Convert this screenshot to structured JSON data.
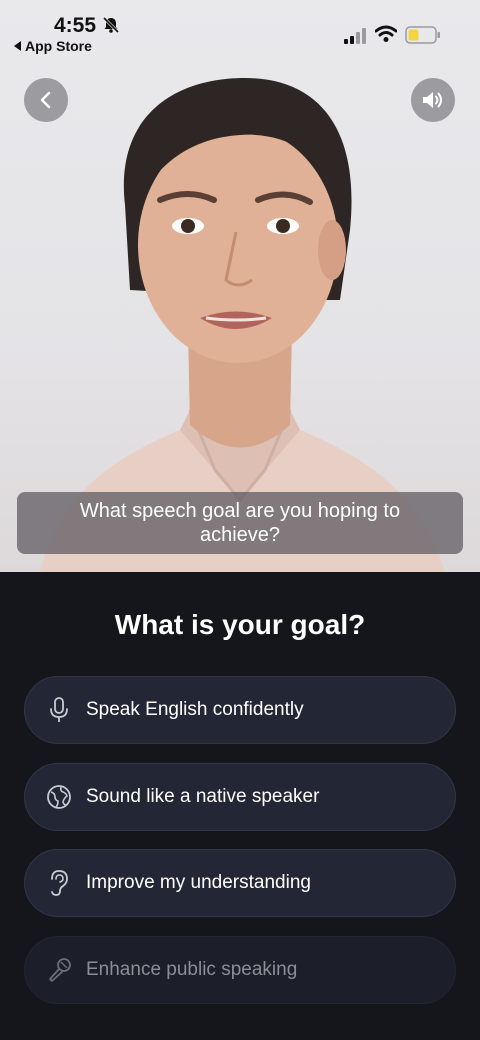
{
  "status_bar": {
    "time": "4:55",
    "back_app": "App Store"
  },
  "video": {
    "caption": "What speech goal are you hoping to achieve?",
    "back_icon": "chevron-left-icon",
    "sound_icon": "speaker-icon"
  },
  "goal": {
    "title": "What is your goal?",
    "options": [
      {
        "label": "Speak English confidently",
        "icon": "microphone-icon"
      },
      {
        "label": "Sound like a native speaker",
        "icon": "globe-icon"
      },
      {
        "label": "Improve my understanding",
        "icon": "ear-icon"
      },
      {
        "label": "Enhance public speaking",
        "icon": "handheld-mic-icon"
      }
    ]
  },
  "colors": {
    "panel_background": "#15151c",
    "option_background": "#232634",
    "battery": "#f5d442"
  }
}
